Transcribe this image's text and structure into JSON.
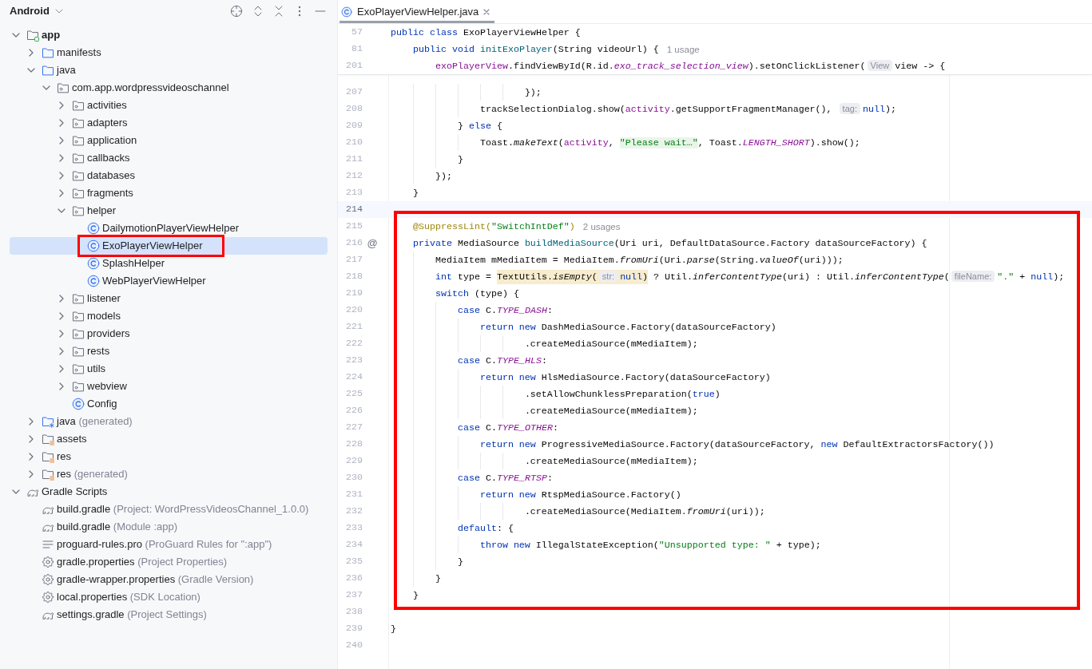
{
  "project_panel": {
    "view_selector": "Android",
    "tree": [
      {
        "label": "app",
        "kind": "module",
        "expanded": true,
        "selected": false,
        "children": [
          {
            "label": "manifests",
            "kind": "folder",
            "expanded": false,
            "selected": false
          },
          {
            "label": "java",
            "kind": "folder",
            "expanded": true,
            "selected": false,
            "children": [
              {
                "label": "com.app.wordpressvideoschannel",
                "kind": "package",
                "expanded": true,
                "selected": false,
                "children": [
                  {
                    "label": "activities",
                    "kind": "package",
                    "expanded": false,
                    "selected": false
                  },
                  {
                    "label": "adapters",
                    "kind": "package",
                    "expanded": false,
                    "selected": false
                  },
                  {
                    "label": "application",
                    "kind": "package",
                    "expanded": false,
                    "selected": false
                  },
                  {
                    "label": "callbacks",
                    "kind": "package",
                    "expanded": false,
                    "selected": false
                  },
                  {
                    "label": "databases",
                    "kind": "package",
                    "expanded": false,
                    "selected": false
                  },
                  {
                    "label": "fragments",
                    "kind": "package",
                    "expanded": false,
                    "selected": false
                  },
                  {
                    "label": "helper",
                    "kind": "package",
                    "expanded": true,
                    "selected": false,
                    "children": [
                      {
                        "label": "DailymotionPlayerViewHelper",
                        "kind": "class",
                        "selected": false
                      },
                      {
                        "label": "ExoPlayerViewHelper",
                        "kind": "class",
                        "selected": true,
                        "framed": true
                      },
                      {
                        "label": "SplashHelper",
                        "kind": "class",
                        "selected": false
                      },
                      {
                        "label": "WebPlayerViewHelper",
                        "kind": "class",
                        "selected": false
                      }
                    ]
                  },
                  {
                    "label": "listener",
                    "kind": "package",
                    "expanded": false,
                    "selected": false
                  },
                  {
                    "label": "models",
                    "kind": "package",
                    "expanded": false,
                    "selected": false
                  },
                  {
                    "label": "providers",
                    "kind": "package",
                    "expanded": false,
                    "selected": false
                  },
                  {
                    "label": "rests",
                    "kind": "package",
                    "expanded": false,
                    "selected": false
                  },
                  {
                    "label": "utils",
                    "kind": "package",
                    "expanded": false,
                    "selected": false
                  },
                  {
                    "label": "webview",
                    "kind": "package",
                    "expanded": false,
                    "selected": false
                  },
                  {
                    "label": "Config",
                    "kind": "class",
                    "selected": false
                  }
                ]
              }
            ]
          },
          {
            "label": "java",
            "note": "(generated)",
            "kind": "generated-folder",
            "expanded": false,
            "selected": false
          },
          {
            "label": "assets",
            "kind": "resource-folder",
            "expanded": false,
            "selected": false
          },
          {
            "label": "res",
            "kind": "resource-folder",
            "expanded": false,
            "selected": false
          },
          {
            "label": "res",
            "note": "(generated)",
            "kind": "resource-folder",
            "expanded": false,
            "selected": false
          }
        ]
      },
      {
        "label": "Gradle Scripts",
        "kind": "gradle",
        "expanded": true,
        "selected": false,
        "children": [
          {
            "label": "build.gradle",
            "note": "(Project: WordPressVideosChannel_1.0.0)",
            "kind": "gradle",
            "selected": false
          },
          {
            "label": "build.gradle",
            "note": "(Module :app)",
            "kind": "gradle",
            "selected": false
          },
          {
            "label": "proguard-rules.pro",
            "note": "(ProGuard Rules for \":app\")",
            "kind": "text",
            "selected": false
          },
          {
            "label": "gradle.properties",
            "note": "(Project Properties)",
            "kind": "properties",
            "selected": false
          },
          {
            "label": "gradle-wrapper.properties",
            "note": "(Gradle Version)",
            "kind": "properties",
            "selected": false
          },
          {
            "label": "local.properties",
            "note": "(SDK Location)",
            "kind": "properties",
            "selected": false
          },
          {
            "label": "settings.gradle",
            "note": "(Project Settings)",
            "kind": "gradle",
            "selected": false
          }
        ]
      }
    ]
  },
  "editor": {
    "tabs": [
      {
        "title": "ExoPlayerViewHelper.java",
        "selected": true
      }
    ],
    "sticky_lines": [
      {
        "number": "57",
        "tokens": [
          {
            "kind": "keyword",
            "text": "public class"
          },
          {
            "kind": "plain",
            "text": " ExoPlayerViewHelper {"
          }
        ]
      },
      {
        "number": "81",
        "tokens": [
          {
            "kind": "keyword",
            "text": "    public void "
          },
          {
            "kind": "method",
            "text": "initExoPlayer"
          },
          {
            "kind": "plain",
            "text": "(String videoUrl) {"
          },
          {
            "kind": "usage",
            "text": "1 usage"
          }
        ]
      },
      {
        "number": "201",
        "tokens": [
          {
            "kind": "field",
            "text": "        exoPlayerView"
          },
          {
            "kind": "plain",
            "text": ".findViewById(R.id."
          },
          {
            "kind": "static-field",
            "text": "exo_track_selection_view"
          },
          {
            "kind": "plain",
            "text": ").setOnClickListener("
          },
          {
            "kind": "hint",
            "text": "View"
          },
          {
            "kind": "plain",
            "text": "view -> {"
          }
        ]
      }
    ],
    "segments": [
      {
        "framed": false,
        "lines": [
          {
            "number": "207",
            "tokens": [
              {
                "kind": "plain",
                "text": "                        });"
              }
            ]
          },
          {
            "number": "208",
            "tokens": [
              {
                "kind": "plain",
                "text": "                trackSelectionDialog.show("
              },
              {
                "kind": "field",
                "text": "activity"
              },
              {
                "kind": "plain",
                "text": ".getSupportFragmentManager(), "
              },
              {
                "kind": "hint",
                "text": "tag:"
              },
              {
                "kind": "keyword",
                "text": "null"
              },
              {
                "kind": "plain",
                "text": ");"
              }
            ]
          },
          {
            "number": "209",
            "tokens": [
              {
                "kind": "plain",
                "text": "            } "
              },
              {
                "kind": "keyword",
                "text": "else"
              },
              {
                "kind": "plain",
                "text": " {"
              }
            ]
          },
          {
            "number": "210",
            "tokens": [
              {
                "kind": "plain",
                "text": "                Toast."
              },
              {
                "kind": "static-call",
                "text": "makeText"
              },
              {
                "kind": "plain",
                "text": "("
              },
              {
                "kind": "field",
                "text": "activity"
              },
              {
                "kind": "plain",
                "text": ", "
              },
              {
                "kind": "folded",
                "text": "\"Please wait…\""
              },
              {
                "kind": "plain",
                "text": ", Toast."
              },
              {
                "kind": "static-field",
                "text": "LENGTH_SHORT"
              },
              {
                "kind": "plain",
                "text": ").show();"
              }
            ]
          },
          {
            "number": "211",
            "tokens": [
              {
                "kind": "plain",
                "text": "            }"
              }
            ]
          },
          {
            "number": "212",
            "tokens": [
              {
                "kind": "plain",
                "text": "        });"
              }
            ]
          },
          {
            "number": "213",
            "tokens": [
              {
                "kind": "plain",
                "text": "    }"
              }
            ]
          },
          {
            "number": "214",
            "current": true
          }
        ]
      },
      {
        "framed": true,
        "lines": [
          {
            "number": "215",
            "tokens": [
              {
                "kind": "annotation",
                "text": "    @SuppressLint("
              },
              {
                "kind": "string",
                "text": "\"SwitchIntDef\""
              },
              {
                "kind": "annotation",
                "text": ")"
              },
              {
                "kind": "usage",
                "text": "2 usages"
              }
            ]
          },
          {
            "number": "216",
            "gutter_mark": "@",
            "tokens": [
              {
                "kind": "keyword",
                "text": "    private"
              },
              {
                "kind": "plain",
                "text": " MediaSource "
              },
              {
                "kind": "method",
                "text": "buildMediaSource"
              },
              {
                "kind": "plain",
                "text": "(Uri uri, DefaultDataSource.Factory dataSourceFactory) {"
              }
            ]
          },
          {
            "number": "217",
            "tokens": [
              {
                "kind": "plain",
                "text": "        MediaItem mMediaItem = MediaItem."
              },
              {
                "kind": "static-call",
                "text": "fromUri"
              },
              {
                "kind": "plain",
                "text": "(Uri."
              },
              {
                "kind": "static-call",
                "text": "parse"
              },
              {
                "kind": "plain",
                "text": "(String."
              },
              {
                "kind": "static-call",
                "text": "valueOf"
              },
              {
                "kind": "plain",
                "text": "(uri)));"
              }
            ]
          },
          {
            "number": "218",
            "tokens": [
              {
                "kind": "keyword",
                "text": "        int"
              },
              {
                "kind": "plain",
                "text": " type = "
              },
              {
                "kind": "warning",
                "parts": [
                  {
                    "kind": "plain",
                    "text": "TextUtils."
                  },
                  {
                    "kind": "static-call",
                    "text": "isEmpty"
                  },
                  {
                    "kind": "plain",
                    "text": "("
                  },
                  {
                    "kind": "hint",
                    "text": "str:"
                  },
                  {
                    "kind": "keyword",
                    "text": "null"
                  },
                  {
                    "kind": "plain",
                    "text": ")"
                  }
                ]
              },
              {
                "kind": "plain",
                "text": " ? Util."
              },
              {
                "kind": "static-call",
                "text": "inferContentType"
              },
              {
                "kind": "plain",
                "text": "(uri) : Util."
              },
              {
                "kind": "static-call",
                "text": "inferContentType"
              },
              {
                "kind": "plain",
                "text": "("
              },
              {
                "kind": "hint",
                "text": "fileName:"
              },
              {
                "kind": "string",
                "text": "\".\""
              },
              {
                "kind": "plain",
                "text": " + "
              },
              {
                "kind": "keyword",
                "text": "null"
              },
              {
                "kind": "plain",
                "text": ");"
              }
            ]
          },
          {
            "number": "219",
            "tokens": [
              {
                "kind": "keyword",
                "text": "        switch"
              },
              {
                "kind": "plain",
                "text": " (type) {"
              }
            ]
          },
          {
            "number": "220",
            "tokens": [
              {
                "kind": "keyword",
                "text": "            case"
              },
              {
                "kind": "plain",
                "text": " C."
              },
              {
                "kind": "static-field",
                "text": "TYPE_DASH"
              },
              {
                "kind": "plain",
                "text": ":"
              }
            ]
          },
          {
            "number": "221",
            "tokens": [
              {
                "kind": "keyword",
                "text": "                return new"
              },
              {
                "kind": "plain",
                "text": " DashMediaSource.Factory(dataSourceFactory)"
              }
            ]
          },
          {
            "number": "222",
            "tokens": [
              {
                "kind": "plain",
                "text": "                        .createMediaSource(mMediaItem);"
              }
            ]
          },
          {
            "number": "223",
            "tokens": [
              {
                "kind": "keyword",
                "text": "            case"
              },
              {
                "kind": "plain",
                "text": " C."
              },
              {
                "kind": "static-field",
                "text": "TYPE_HLS"
              },
              {
                "kind": "plain",
                "text": ":"
              }
            ]
          },
          {
            "number": "224",
            "tokens": [
              {
                "kind": "keyword",
                "text": "                return new"
              },
              {
                "kind": "plain",
                "text": " HlsMediaSource.Factory(dataSourceFactory)"
              }
            ]
          },
          {
            "number": "225",
            "tokens": [
              {
                "kind": "plain",
                "text": "                        .setAllowChunklessPreparation("
              },
              {
                "kind": "keyword",
                "text": "true"
              },
              {
                "kind": "plain",
                "text": ")"
              }
            ]
          },
          {
            "number": "226",
            "tokens": [
              {
                "kind": "plain",
                "text": "                        .createMediaSource(mMediaItem);"
              }
            ]
          },
          {
            "number": "227",
            "tokens": [
              {
                "kind": "keyword",
                "text": "            case"
              },
              {
                "kind": "plain",
                "text": " C."
              },
              {
                "kind": "static-field",
                "text": "TYPE_OTHER"
              },
              {
                "kind": "plain",
                "text": ":"
              }
            ]
          },
          {
            "number": "228",
            "tokens": [
              {
                "kind": "keyword",
                "text": "                return new"
              },
              {
                "kind": "plain",
                "text": " ProgressiveMediaSource.Factory(dataSourceFactory, "
              },
              {
                "kind": "keyword",
                "text": "new"
              },
              {
                "kind": "plain",
                "text": " DefaultExtractorsFactory())"
              }
            ]
          },
          {
            "number": "229",
            "tokens": [
              {
                "kind": "plain",
                "text": "                        .createMediaSource(mMediaItem);"
              }
            ]
          },
          {
            "number": "230",
            "tokens": [
              {
                "kind": "keyword",
                "text": "            case"
              },
              {
                "kind": "plain",
                "text": " C."
              },
              {
                "kind": "static-field",
                "text": "TYPE_RTSP"
              },
              {
                "kind": "plain",
                "text": ":"
              }
            ]
          },
          {
            "number": "231",
            "tokens": [
              {
                "kind": "keyword",
                "text": "                return new"
              },
              {
                "kind": "plain",
                "text": " RtspMediaSource.Factory()"
              }
            ]
          },
          {
            "number": "232",
            "tokens": [
              {
                "kind": "plain",
                "text": "                        .createMediaSource(MediaItem."
              },
              {
                "kind": "static-call",
                "text": "fromUri"
              },
              {
                "kind": "plain",
                "text": "(uri));"
              }
            ]
          },
          {
            "number": "233",
            "tokens": [
              {
                "kind": "keyword",
                "text": "            default"
              },
              {
                "kind": "plain",
                "text": ": {"
              }
            ]
          },
          {
            "number": "234",
            "tokens": [
              {
                "kind": "keyword",
                "text": "                throw new"
              },
              {
                "kind": "plain",
                "text": " IllegalStateException("
              },
              {
                "kind": "string",
                "text": "\"Unsupported type: \""
              },
              {
                "kind": "plain",
                "text": " + type);"
              }
            ]
          },
          {
            "number": "235",
            "tokens": [
              {
                "kind": "plain",
                "text": "            }"
              }
            ]
          },
          {
            "number": "236",
            "tokens": [
              {
                "kind": "plain",
                "text": "        }"
              }
            ]
          },
          {
            "number": "237",
            "tokens": [
              {
                "kind": "plain",
                "text": "    }"
              }
            ]
          }
        ]
      },
      {
        "framed": false,
        "lines": [
          {
            "number": "238"
          },
          {
            "number": "239",
            "tokens": [
              {
                "kind": "plain",
                "text": "}"
              }
            ]
          },
          {
            "number": "240"
          }
        ]
      }
    ]
  }
}
